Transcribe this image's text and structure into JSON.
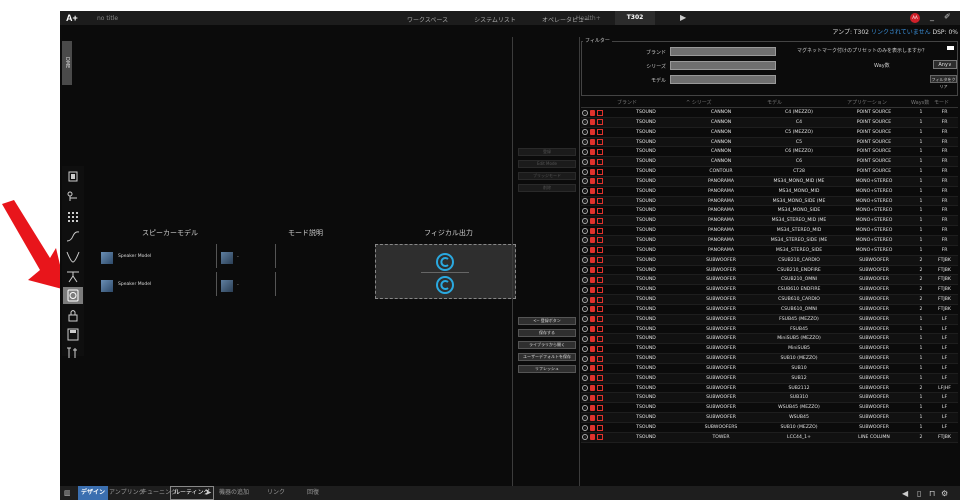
{
  "app": {
    "logo": "A+",
    "doc_title": "no title",
    "menus": [
      "ワークスペース",
      "システムリスト",
      "オペレータビュー"
    ],
    "health_tab": "Health+",
    "active_tab": "T302",
    "avatar": "AA"
  },
  "status": {
    "amp_label": "アンプ: T302",
    "link_status": "リンクされていません",
    "dsp": "DSP: 0%"
  },
  "left_tab": "DME",
  "center": {
    "col_speaker_model": "スピーカーモデル",
    "col_mode_desc": "モード説明",
    "col_physical_output": "フィジカル出力",
    "rows": [
      {
        "speaker": "Speaker Model",
        "mode": "-"
      },
      {
        "speaker": "Speaker Model",
        "mode": "-"
      }
    ]
  },
  "mid_buttons_top": [
    "登録",
    "Edit Mode",
    "ブリッジモード",
    "削除"
  ],
  "mid_buttons_bottom": [
    "<-- 登録ボタン",
    "保存する",
    "ライブラリから開く",
    "ユーザーデフォルトを保存",
    "リフレッシュ"
  ],
  "filter": {
    "label": "フィルター",
    "brand_label": "ブランド",
    "series_label": "シリーズ",
    "model_label": "モデル",
    "question": "マグネットマーク付けのプリセットのみを表示しますか？",
    "ways_label": "Way数",
    "ways_value": "Any",
    "clear_button": "フィルタをクリア"
  },
  "table": {
    "headers": [
      "ブランド",
      "^ シリーズ",
      "モデル",
      "アプリケーション",
      "Ways数",
      "モード"
    ],
    "rows": [
      [
        "TSOUND",
        "CANNON",
        "C4 (MEZZO)",
        "POINT SOURCE",
        "1",
        "FR"
      ],
      [
        "TSOUND",
        "CANNON",
        "C4",
        "POINT SOURCE",
        "1",
        "FR"
      ],
      [
        "TSOUND",
        "CANNON",
        "C5 (MEZZO)",
        "POINT SOURCE",
        "1",
        "FR"
      ],
      [
        "TSOUND",
        "CANNON",
        "C5",
        "POINT SOURCE",
        "1",
        "FR"
      ],
      [
        "TSOUND",
        "CANNON",
        "C6 (MEZZO)",
        "POINT SOURCE",
        "1",
        "FR"
      ],
      [
        "TSOUND",
        "CANNON",
        "C6",
        "POINT SOURCE",
        "1",
        "FR"
      ],
      [
        "TSOUND",
        "CONTOUR",
        "CT28",
        "POINT SOURCE",
        "1",
        "FR"
      ],
      [
        "TSOUND",
        "PANORAMA",
        "MS34_MONO_MID (ME",
        "MONO+STEREO",
        "1",
        "FR"
      ],
      [
        "TSOUND",
        "PANORAMA",
        "MS34_MONO_MID",
        "MONO+STEREO",
        "1",
        "FR"
      ],
      [
        "TSOUND",
        "PANORAMA",
        "MS34_MONO_SIDE (ME",
        "MONO+STEREO",
        "1",
        "FR"
      ],
      [
        "TSOUND",
        "PANORAMA",
        "MS34_MONO_SIDE",
        "MONO+STEREO",
        "1",
        "FR"
      ],
      [
        "TSOUND",
        "PANORAMA",
        "MS34_STEREO_MID (ME",
        "MONO+STEREO",
        "1",
        "FR"
      ],
      [
        "TSOUND",
        "PANORAMA",
        "MS34_STEREO_MID",
        "MONO+STEREO",
        "1",
        "FR"
      ],
      [
        "TSOUND",
        "PANORAMA",
        "MS34_STEREO_SIDE (ME",
        "MONO+STEREO",
        "1",
        "FR"
      ],
      [
        "TSOUND",
        "PANORAMA",
        "MS34_STEREO_SIDE",
        "MONO+STEREO",
        "1",
        "FR"
      ],
      [
        "TSOUND",
        "SUBWOOFER",
        "CSUB210_CARDIO",
        "SUBWOOFER",
        "2",
        "FTJBK"
      ],
      [
        "TSOUND",
        "SUBWOOFER",
        "CSUB210_ENDFIRE",
        "SUBWOOFER",
        "2",
        "FTJBK"
      ],
      [
        "TSOUND",
        "SUBWOOFER",
        "CSUB210_OMNI",
        "SUBWOOFER",
        "2",
        "FTJBK"
      ],
      [
        "TSOUND",
        "SUBWOOFER",
        "CSUB610 ENDFIRE",
        "SUBWOOFER",
        "2",
        "FTJBK"
      ],
      [
        "TSOUND",
        "SUBWOOFER",
        "CSUB610_CARDIO",
        "SUBWOOFER",
        "2",
        "FTJBK"
      ],
      [
        "TSOUND",
        "SUBWOOFER",
        "CSUB610_OMNI",
        "SUBWOOFER",
        "2",
        "FTJBK"
      ],
      [
        "TSOUND",
        "SUBWOOFER",
        "FSUB45 (MEZZO)",
        "SUBWOOFER",
        "1",
        "LF"
      ],
      [
        "TSOUND",
        "SUBWOOFER",
        "FSUB45",
        "SUBWOOFER",
        "1",
        "LF"
      ],
      [
        "TSOUND",
        "SUBWOOFER",
        "MiniSUB5 (MEZZO)",
        "SUBWOOFER",
        "1",
        "LF"
      ],
      [
        "TSOUND",
        "SUBWOOFER",
        "MiniSUB5",
        "SUBWOOFER",
        "1",
        "LF"
      ],
      [
        "TSOUND",
        "SUBWOOFER",
        "SUB10 (MEZZO)",
        "SUBWOOFER",
        "1",
        "LF"
      ],
      [
        "TSOUND",
        "SUBWOOFER",
        "SUB10",
        "SUBWOOFER",
        "1",
        "LF"
      ],
      [
        "TSOUND",
        "SUBWOOFER",
        "SUB12",
        "SUBWOOFER",
        "1",
        "LF"
      ],
      [
        "TSOUND",
        "SUBWOOFER",
        "SUB2112",
        "SUBWOOFER",
        "2",
        "LF|HF"
      ],
      [
        "TSOUND",
        "SUBWOOFER",
        "SUB310",
        "SUBWOOFER",
        "1",
        "LF"
      ],
      [
        "TSOUND",
        "SUBWOOFER",
        "WSUB45 (MEZZO)",
        "SUBWOOFER",
        "1",
        "LF"
      ],
      [
        "TSOUND",
        "SUBWOOFER",
        "WSUB45",
        "SUBWOOFER",
        "1",
        "LF"
      ],
      [
        "TSOUND",
        "SUBWOOFERS",
        "SUB10 (MEZZO)",
        "SUBWOOFER",
        "1",
        "LF"
      ],
      [
        "TSOUND",
        "TOWER",
        "LCC44_1+",
        "LINE COLUMN",
        "2",
        "FTJBK"
      ]
    ]
  },
  "bottom": {
    "tabs": [
      "デザイン",
      "アンプリング",
      "チューニング",
      "ルーティング",
      "機器の追加",
      "リンク",
      "回復"
    ]
  },
  "colors": {
    "accent_blue": "#3b6fb0",
    "link_blue": "#3a8fd9",
    "alert_red": "#e0322c"
  }
}
